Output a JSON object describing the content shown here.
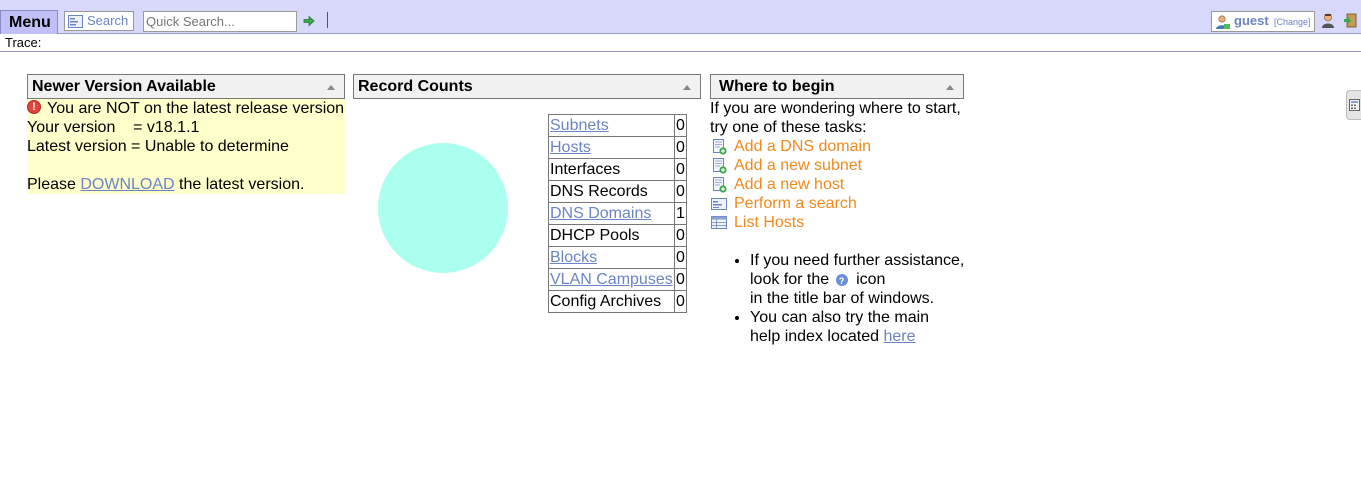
{
  "topbar": {
    "menu_label": "Menu",
    "search_label": "Search",
    "quick_search_placeholder": "Quick Search...",
    "user": {
      "name": "guest",
      "change_label": "[Change]"
    }
  },
  "trace": {
    "label": "Trace:"
  },
  "panels": {
    "newer_version": {
      "title": "Newer Version Available",
      "warning": "You are NOT on the latest release version",
      "your_version": "Your version    = v18.1.1",
      "latest_version": "Latest version = Unable to determine",
      "download_prefix": "Please ",
      "download_link": "DOWNLOAD",
      "download_suffix": " the latest version."
    },
    "record_counts": {
      "title": "Record Counts",
      "rows": [
        {
          "name": "Subnets",
          "count": "0",
          "link": true
        },
        {
          "name": "Hosts",
          "count": "0",
          "link": true
        },
        {
          "name": "Interfaces",
          "count": "0",
          "link": false
        },
        {
          "name": "DNS Records",
          "count": "0",
          "link": false
        },
        {
          "name": "DNS Domains",
          "count": "1",
          "link": true
        },
        {
          "name": "DHCP Pools",
          "count": "0",
          "link": false
        },
        {
          "name": "Blocks",
          "count": "0",
          "link": true
        },
        {
          "name": "VLAN Campuses",
          "count": "0",
          "link": true
        },
        {
          "name": "Config Archives",
          "count": "0",
          "link": false
        }
      ],
      "pie_color": "#aaffee"
    },
    "where_to_begin": {
      "title": "Where to begin",
      "intro_line1": "If you are wondering where to start,",
      "intro_line2": "try one of these tasks:",
      "tasks": [
        {
          "label": "Add a DNS domain",
          "icon": "add-page-icon"
        },
        {
          "label": "Add a new subnet",
          "icon": "add-page-icon"
        },
        {
          "label": "Add a new host",
          "icon": "add-page-icon"
        },
        {
          "label": "Perform a search",
          "icon": "search-form-icon"
        },
        {
          "label": "List Hosts",
          "icon": "list-table-icon"
        }
      ],
      "help1_a": "If you need further assistance,",
      "help1_b": "look for the",
      "help1_c": "icon",
      "help1_d": "in the title bar of windows.",
      "help2_a": "You can also try the main",
      "help2_b": "help index located ",
      "help2_link": "here"
    }
  },
  "colors": {
    "accent": "#6b84c4",
    "task": "#f08a1e",
    "topbar": "#d8d8fa",
    "notice_bg": "#ffffcc"
  }
}
